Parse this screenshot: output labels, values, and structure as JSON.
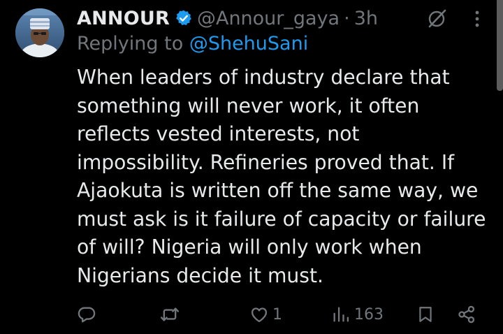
{
  "post": {
    "display_name": "ANNOUR",
    "handle": "@Annour_gaya",
    "separator": "·",
    "time": "3h",
    "replying_prefix": "Replying to",
    "replying_to": "@ShehuSani",
    "body_lines": [
      "When leaders of industry declare that",
      "something will never work, it often",
      "reflects vested interests, not",
      "impossibility. Refineries proved that. If",
      "Ajaokuta is written off the same way, we",
      "must ask is it failure of capacity or failure",
      "of will? Nigeria will only work when",
      "Nigerians decide it must."
    ]
  },
  "actions": {
    "reply": {
      "icon": "reply-icon",
      "count": ""
    },
    "repost": {
      "icon": "repost-icon",
      "count": ""
    },
    "like": {
      "icon": "heart-icon",
      "count": "1"
    },
    "views": {
      "icon": "views-icon",
      "count": "163"
    },
    "bookmark": {
      "icon": "bookmark-icon"
    },
    "share": {
      "icon": "share-icon"
    }
  },
  "colors": {
    "background": "#000000",
    "text": "#e7e9ea",
    "muted": "#71767b",
    "accent": "#1d9bf0"
  }
}
